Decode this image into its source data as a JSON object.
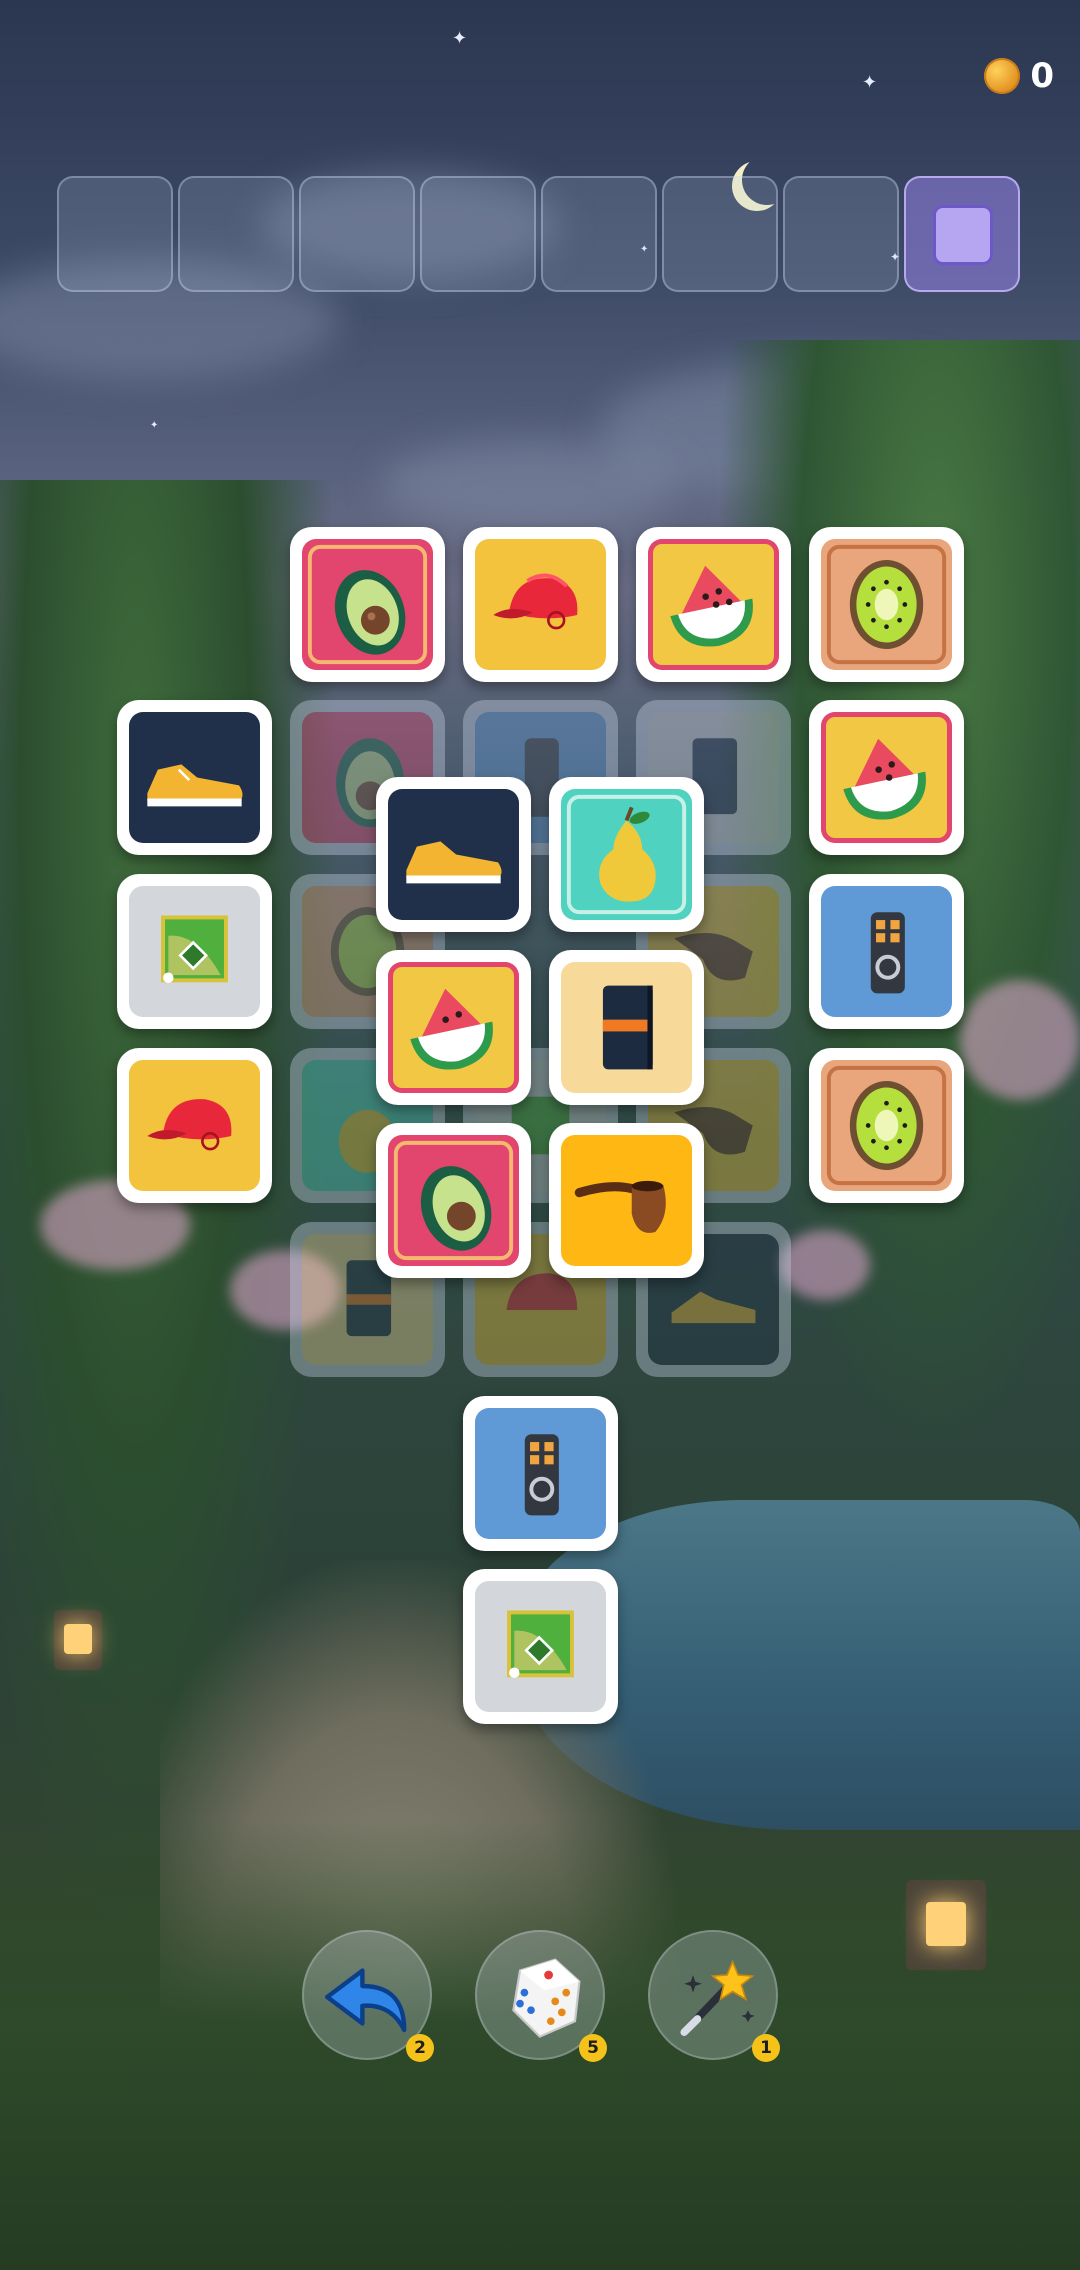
{
  "hud": {
    "coin_icon": "coin-icon",
    "coin_count": "0",
    "coin_color": "#f0a52a"
  },
  "tray": {
    "slot_count": 8,
    "active_slot": 8
  },
  "tiles": [
    {
      "item": "avocado",
      "state": "active"
    },
    {
      "item": "baseball-cap",
      "state": "active"
    },
    {
      "item": "watermelon",
      "state": "active"
    },
    {
      "item": "kiwi",
      "state": "active"
    },
    {
      "item": "sneaker",
      "state": "active"
    },
    {
      "item": "watermelon",
      "state": "active"
    },
    {
      "item": "baseball-field",
      "state": "active"
    },
    {
      "item": "remote",
      "state": "active"
    },
    {
      "item": "baseball-cap",
      "state": "active"
    },
    {
      "item": "kiwi",
      "state": "active"
    },
    {
      "item": "sneaker",
      "state": "active"
    },
    {
      "item": "pear",
      "state": "active"
    },
    {
      "item": "watermelon",
      "state": "active"
    },
    {
      "item": "notebook",
      "state": "active"
    },
    {
      "item": "avocado",
      "state": "active"
    },
    {
      "item": "pipe",
      "state": "active"
    },
    {
      "item": "remote",
      "state": "active"
    },
    {
      "item": "baseball-field",
      "state": "active"
    }
  ],
  "powerups": {
    "undo": {
      "icon": "undo-arrow-icon",
      "count": "2"
    },
    "shuffle": {
      "icon": "dice-icon",
      "count": "5"
    },
    "magic": {
      "icon": "magic-wand-icon",
      "count": "1"
    }
  }
}
